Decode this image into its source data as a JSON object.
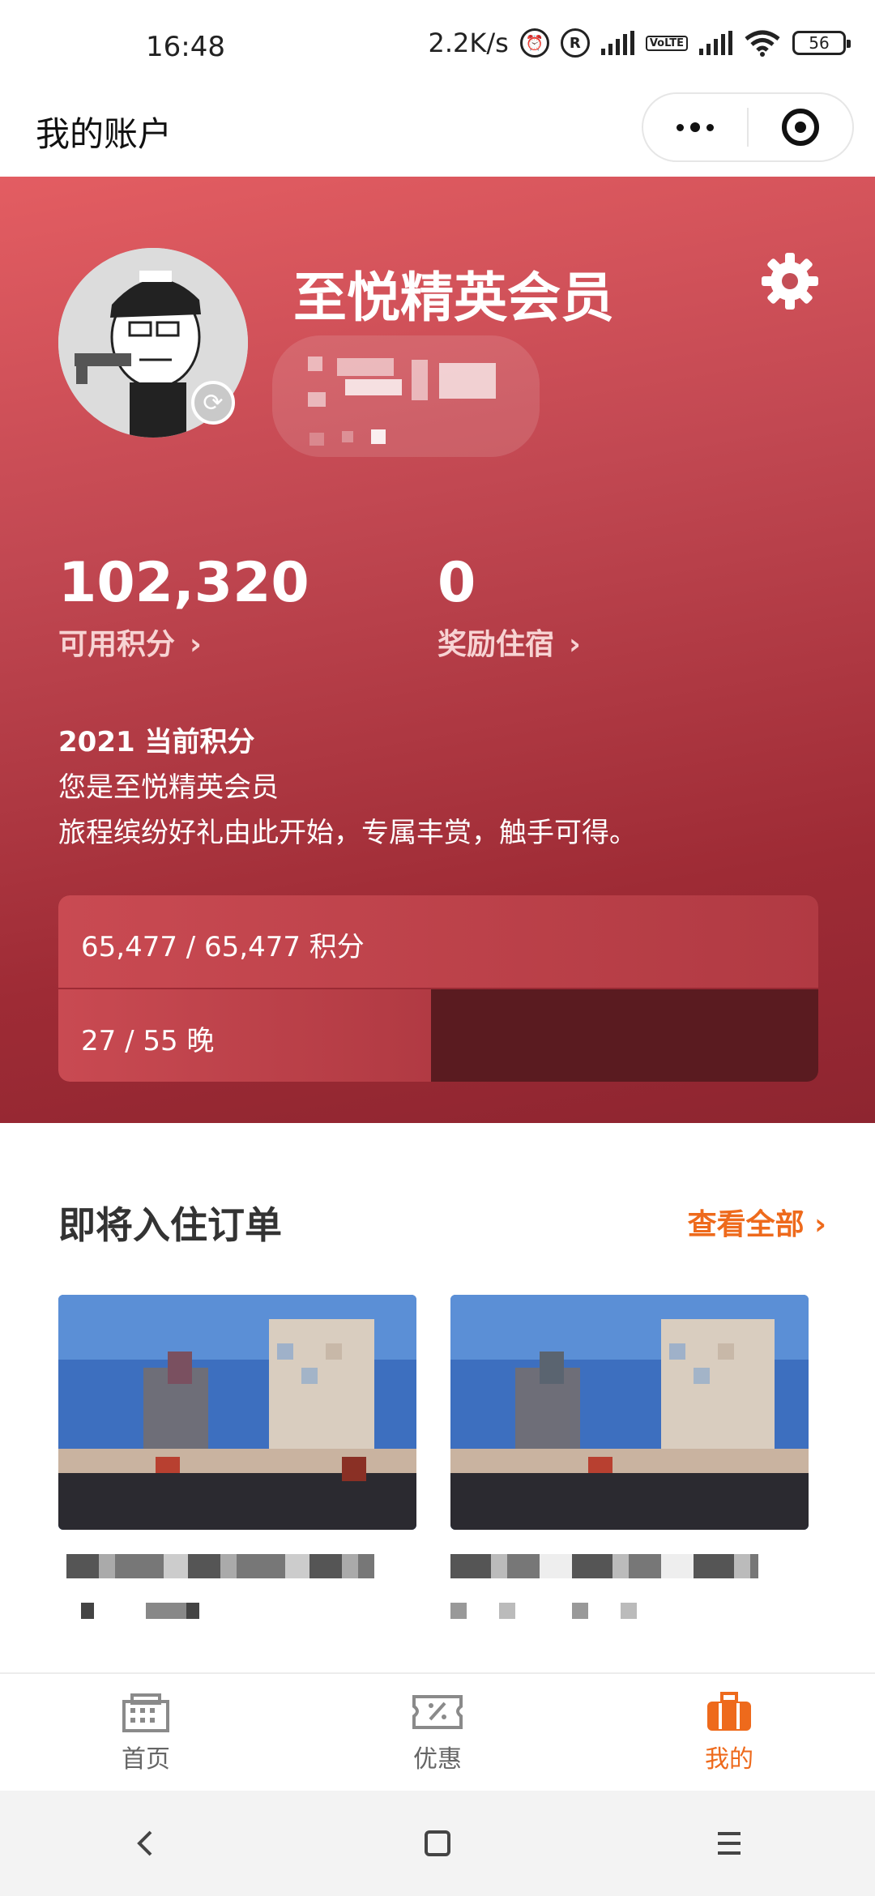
{
  "status_bar": {
    "time": "16:48",
    "net_speed": "2.2K/s",
    "registered_symbol": "R",
    "volte": "VoLTE",
    "battery": "56"
  },
  "title_bar": {
    "title": "我的账户",
    "more_icon": "more-dots-icon",
    "close_icon": "target-icon"
  },
  "profile": {
    "member_level": "至悦精英会员",
    "settings_icon": "gear-icon",
    "avatar_icon": "avatar-police-cartoon",
    "refresh_icon": "refresh-icon"
  },
  "stats": {
    "points_value": "102,320",
    "points_label": "可用积分",
    "reward_value": "0",
    "reward_label": "奖励住宿",
    "chevron": "›"
  },
  "current": {
    "heading": "2021 当前积分",
    "line1": "您是至悦精英会员",
    "line2": "旅程缤纷好礼由此开始，专属丰赏，触手可得。"
  },
  "progress": {
    "points_text": "65,477 / 65,477 积分",
    "points_fraction": 1.0,
    "nights_text": "27 / 55 晚",
    "nights_fraction": 0.49
  },
  "upcoming": {
    "title": "即将入住订单",
    "view_all": "查看全部 ›"
  },
  "tabbar": {
    "items": [
      {
        "label": "首页",
        "icon": "building-icon"
      },
      {
        "label": "优惠",
        "icon": "coupon-icon"
      },
      {
        "label": "我的",
        "icon": "briefcase-icon"
      }
    ],
    "active_color": "#ee6a1c"
  },
  "colors": {
    "hero_gradient_start": "#e35d62",
    "hero_gradient_end": "#8e2530",
    "accent_orange": "#ee6a1c"
  }
}
